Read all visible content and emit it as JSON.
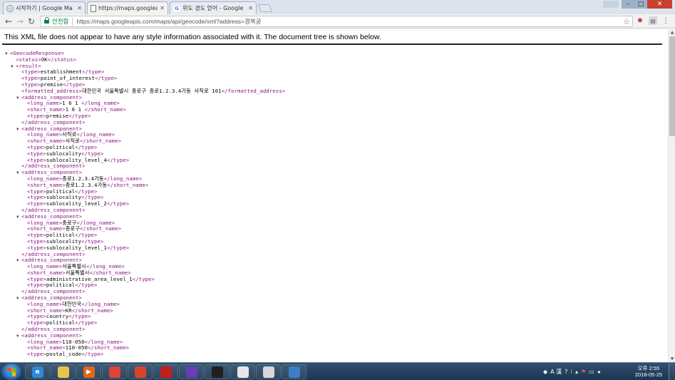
{
  "browser": {
    "tabs": [
      {
        "label": "시작하기 | Google Ma",
        "icon": "google-maps-icon",
        "active": false
      },
      {
        "label": "https://maps.googleapis",
        "icon": "page-icon",
        "active": true
      },
      {
        "label": "위도 경도 얻어 - Google",
        "icon": "google-search-icon",
        "active": false
      }
    ],
    "secure_label": "안전함",
    "url": "https://maps.googleapis.com/maps/api/geocode/xml?address=경복궁",
    "colors": {
      "secure": "#0b8043",
      "tag": "#881280"
    }
  },
  "xml_viewer": {
    "notice": "This XML file does not appear to have any style information associated with it. The document tree is shown below.",
    "lines": [
      {
        "indent": 0,
        "toggle": true,
        "text": "<GeocodeResponse>",
        "kind": "tag"
      },
      {
        "indent": 1,
        "toggle": false,
        "open": "<status>",
        "value": "OK",
        "close": "</status>"
      },
      {
        "indent": 1,
        "toggle": true,
        "text": "<result>",
        "kind": "tag"
      },
      {
        "indent": 2,
        "toggle": false,
        "open": "<type>",
        "value": "establishment",
        "close": "</type>"
      },
      {
        "indent": 2,
        "toggle": false,
        "open": "<type>",
        "value": "point_of_interest",
        "close": "</type>"
      },
      {
        "indent": 2,
        "toggle": false,
        "open": "<type>",
        "value": "premise",
        "close": "</type>"
      },
      {
        "indent": 2,
        "toggle": false,
        "open": "<formatted_address>",
        "value": "대한민국 서울특별시 종로구 종로1.2.3.4가동 사직로 161",
        "close": "</formatted_address>"
      },
      {
        "indent": 2,
        "toggle": true,
        "text": "<address_component>",
        "kind": "tag"
      },
      {
        "indent": 3,
        "toggle": false,
        "open": "<long_name>",
        "value": "1 6 1 ",
        "close": "</long_name>"
      },
      {
        "indent": 3,
        "toggle": false,
        "open": "<short_name>",
        "value": "1 6 1 ",
        "close": "</short_name>"
      },
      {
        "indent": 3,
        "toggle": false,
        "open": "<type>",
        "value": "premise",
        "close": "</type>"
      },
      {
        "indent": 2,
        "toggle": false,
        "text": "</address_component>",
        "kind": "tag"
      },
      {
        "indent": 2,
        "toggle": true,
        "text": "<address_component>",
        "kind": "tag"
      },
      {
        "indent": 3,
        "toggle": false,
        "open": "<long_name>",
        "value": "사직로",
        "close": "</long_name>"
      },
      {
        "indent": 3,
        "toggle": false,
        "open": "<short_name>",
        "value": "사직로",
        "close": "</short_name>"
      },
      {
        "indent": 3,
        "toggle": false,
        "open": "<type>",
        "value": "political",
        "close": "</type>"
      },
      {
        "indent": 3,
        "toggle": false,
        "open": "<type>",
        "value": "sublocality",
        "close": "</type>"
      },
      {
        "indent": 3,
        "toggle": false,
        "open": "<type>",
        "value": "sublocality_level_4",
        "close": "</type>"
      },
      {
        "indent": 2,
        "toggle": false,
        "text": "</address_component>",
        "kind": "tag"
      },
      {
        "indent": 2,
        "toggle": true,
        "text": "<address_component>",
        "kind": "tag"
      },
      {
        "indent": 3,
        "toggle": false,
        "open": "<long_name>",
        "value": "종로1.2.3.4가동",
        "close": "</long_name>"
      },
      {
        "indent": 3,
        "toggle": false,
        "open": "<short_name>",
        "value": "종로1.2.3.4가동",
        "close": "</short_name>"
      },
      {
        "indent": 3,
        "toggle": false,
        "open": "<type>",
        "value": "political",
        "close": "</type>"
      },
      {
        "indent": 3,
        "toggle": false,
        "open": "<type>",
        "value": "sublocality",
        "close": "</type>"
      },
      {
        "indent": 3,
        "toggle": false,
        "open": "<type>",
        "value": "sublocality_level_2",
        "close": "</type>"
      },
      {
        "indent": 2,
        "toggle": false,
        "text": "</address_component>",
        "kind": "tag"
      },
      {
        "indent": 2,
        "toggle": true,
        "text": "<address_component>",
        "kind": "tag"
      },
      {
        "indent": 3,
        "toggle": false,
        "open": "<long_name>",
        "value": "종로구",
        "close": "</long_name>"
      },
      {
        "indent": 3,
        "toggle": false,
        "open": "<short_name>",
        "value": "종로구",
        "close": "</short_name>"
      },
      {
        "indent": 3,
        "toggle": false,
        "open": "<type>",
        "value": "political",
        "close": "</type>"
      },
      {
        "indent": 3,
        "toggle": false,
        "open": "<type>",
        "value": "sublocality",
        "close": "</type>"
      },
      {
        "indent": 3,
        "toggle": false,
        "open": "<type>",
        "value": "sublocality_level_1",
        "close": "</type>"
      },
      {
        "indent": 2,
        "toggle": false,
        "text": "</address_component>",
        "kind": "tag"
      },
      {
        "indent": 2,
        "toggle": true,
        "text": "<address_component>",
        "kind": "tag"
      },
      {
        "indent": 3,
        "toggle": false,
        "open": "<long_name>",
        "value": "서울특별시",
        "close": "</long_name>"
      },
      {
        "indent": 3,
        "toggle": false,
        "open": "<short_name>",
        "value": "서울특별시",
        "close": "</short_name>"
      },
      {
        "indent": 3,
        "toggle": false,
        "open": "<type>",
        "value": "administrative_area_level_1",
        "close": "</type>"
      },
      {
        "indent": 3,
        "toggle": false,
        "open": "<type>",
        "value": "political",
        "close": "</type>"
      },
      {
        "indent": 2,
        "toggle": false,
        "text": "</address_component>",
        "kind": "tag"
      },
      {
        "indent": 2,
        "toggle": true,
        "text": "<address_component>",
        "kind": "tag"
      },
      {
        "indent": 3,
        "toggle": false,
        "open": "<long_name>",
        "value": "대한민국",
        "close": "</long_name>"
      },
      {
        "indent": 3,
        "toggle": false,
        "open": "<short_name>",
        "value": "KR",
        "close": "</short_name>"
      },
      {
        "indent": 3,
        "toggle": false,
        "open": "<type>",
        "value": "country",
        "close": "</type>"
      },
      {
        "indent": 3,
        "toggle": false,
        "open": "<type>",
        "value": "political",
        "close": "</type>"
      },
      {
        "indent": 2,
        "toggle": false,
        "text": "</address_component>",
        "kind": "tag"
      },
      {
        "indent": 2,
        "toggle": true,
        "text": "<address_component>",
        "kind": "tag"
      },
      {
        "indent": 3,
        "toggle": false,
        "open": "<long_name>",
        "value": "110-050",
        "close": "</long_name>"
      },
      {
        "indent": 3,
        "toggle": false,
        "open": "<short_name>",
        "value": "110-050",
        "close": "</short_name>"
      },
      {
        "indent": 3,
        "toggle": false,
        "open": "<type>",
        "value": "postal_code",
        "close": "</type>"
      }
    ]
  },
  "taskbar": {
    "apps": [
      {
        "name": "ie-icon",
        "glyph": "e",
        "color": "#2d8ad6"
      },
      {
        "name": "file-explorer-icon",
        "glyph": "",
        "color": "#e8c44a"
      },
      {
        "name": "media-player-icon",
        "glyph": "▶",
        "color": "#e0661e"
      },
      {
        "name": "chrome-icon",
        "glyph": "",
        "color": "#db4437"
      },
      {
        "name": "app-red-icon",
        "glyph": "",
        "color": "#d9452b"
      },
      {
        "name": "pdf-reader-icon",
        "glyph": "",
        "color": "#c41f1f"
      },
      {
        "name": "visual-studio-icon",
        "glyph": "",
        "color": "#6a3cb8"
      },
      {
        "name": "terminal-icon",
        "glyph": "",
        "color": "#202020"
      },
      {
        "name": "java-icon",
        "glyph": "",
        "color": "#e7e7e7"
      },
      {
        "name": "search-tool-icon",
        "glyph": "",
        "color": "#d8d8d8"
      },
      {
        "name": "app-blue-icon",
        "glyph": "",
        "color": "#3d7fc4"
      }
    ],
    "tray": {
      "ime": "A 漢",
      "time": "오후 2:55",
      "date": "2018-05-25"
    }
  }
}
